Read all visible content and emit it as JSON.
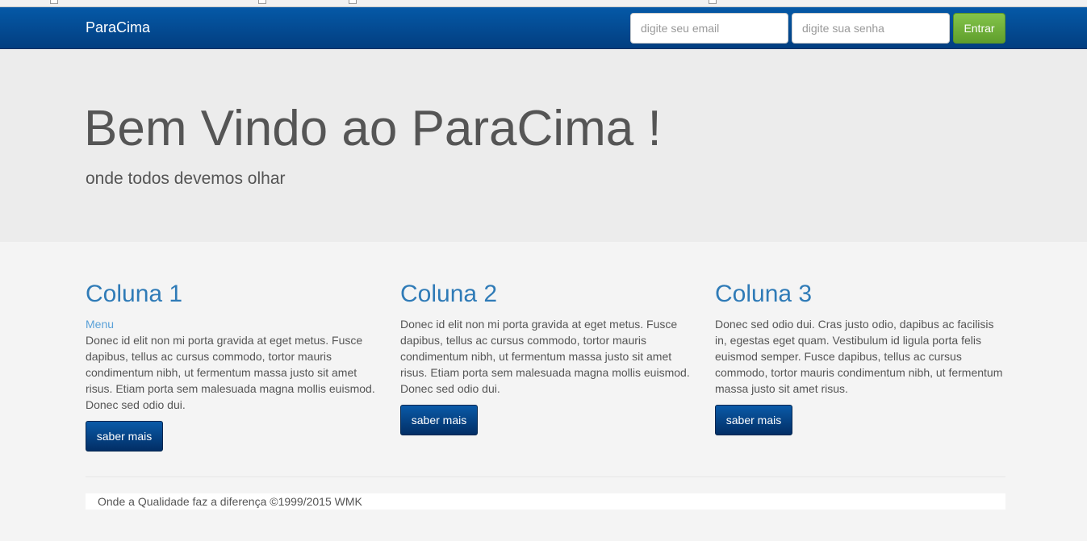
{
  "navbar": {
    "brand": "ParaCima",
    "email_placeholder": "digite seu email",
    "senha_placeholder": "digite sua senha",
    "entrar_label": "Entrar"
  },
  "hero": {
    "title": "Bem Vindo ao ParaCima !",
    "subtitle": "onde todos devemos olhar"
  },
  "columns": [
    {
      "title": "Coluna 1",
      "link": "Menu",
      "text": "Donec id elit non mi porta gravida at eget metus. Fusce dapibus, tellus ac cursus commodo, tortor mauris condimentum nibh, ut fermentum massa justo sit amet risus. Etiam porta sem malesuada magna mollis euismod. Donec sed odio dui.",
      "button": "saber mais"
    },
    {
      "title": "Coluna 2",
      "text": "Donec id elit non mi porta gravida at eget metus. Fusce dapibus, tellus ac cursus commodo, tortor mauris condimentum nibh, ut fermentum massa justo sit amet risus. Etiam porta sem malesuada magna mollis euismod. Donec sed odio dui.",
      "button": "saber mais"
    },
    {
      "title": "Coluna 3",
      "text": "Donec sed odio dui. Cras justo odio, dapibus ac facilisis in, egestas eget quam. Vestibulum id ligula porta felis euismod semper. Fusce dapibus, tellus ac cursus commodo, tortor mauris condimentum nibh, ut fermentum massa justo sit amet risus.",
      "button": "saber mais"
    }
  ],
  "footer": {
    "text": "Onde a Qualidade faz a diferença ©1999/2015 WMK"
  },
  "colors": {
    "navbar": "#034a93",
    "link": "#2f7bb7",
    "entrar_button": "#6fb03a"
  }
}
